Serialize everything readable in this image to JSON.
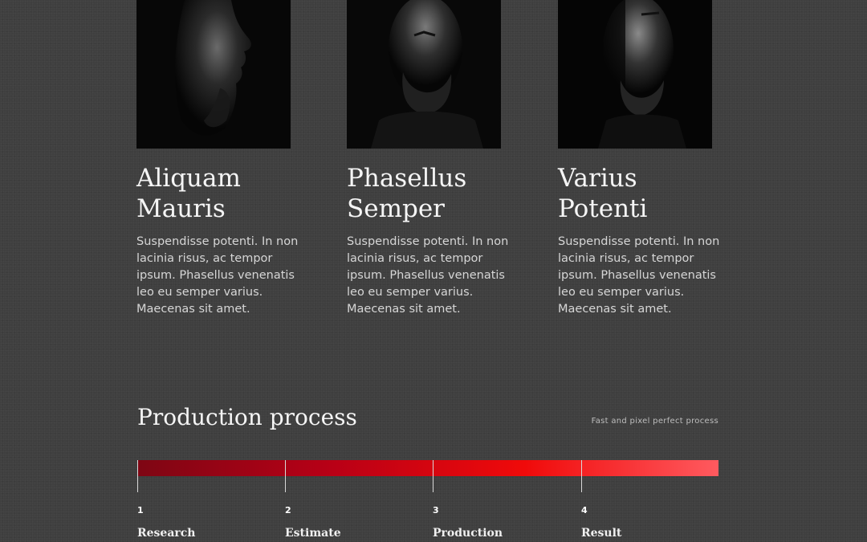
{
  "team": {
    "members": [
      {
        "name": "Aliquam Mauris",
        "bio": "Suspendisse potenti. In non lacinia risus, ac tempor ipsum. Phasellus venenatis leo eu semper varius. Maecenas sit amet.",
        "photo_icon": "portrait-profile-photo"
      },
      {
        "name": "Phasellus Semper",
        "bio": "Suspendisse potenti. In non lacinia risus, ac tempor ipsum. Phasellus venenatis leo eu semper varius. Maecenas sit amet.",
        "photo_icon": "portrait-downcast-photo"
      },
      {
        "name": "Varius Potenti",
        "bio": "Suspendisse potenti. In non lacinia risus, ac tempor ipsum. Phasellus venenatis leo eu semper varius. Maecenas sit amet.",
        "photo_icon": "portrait-frontal-photo"
      }
    ]
  },
  "process": {
    "title": "Production process",
    "tagline": "Fast and pixel perfect process",
    "progress_percent": 100,
    "gradient_colors": [
      "#7e0614",
      "#b80016",
      "#f00a0a",
      "#ff5a5f"
    ],
    "steps": [
      {
        "number": "1",
        "label": "Research"
      },
      {
        "number": "2",
        "label": "Estimate"
      },
      {
        "number": "3",
        "label": "Production"
      },
      {
        "number": "4",
        "label": "Result"
      }
    ]
  },
  "colors": {
    "background": "#3f3f3f",
    "heading_text": "#f5f5f5",
    "body_text": "#d6d6d6",
    "accent_red": "#f00a0a"
  }
}
